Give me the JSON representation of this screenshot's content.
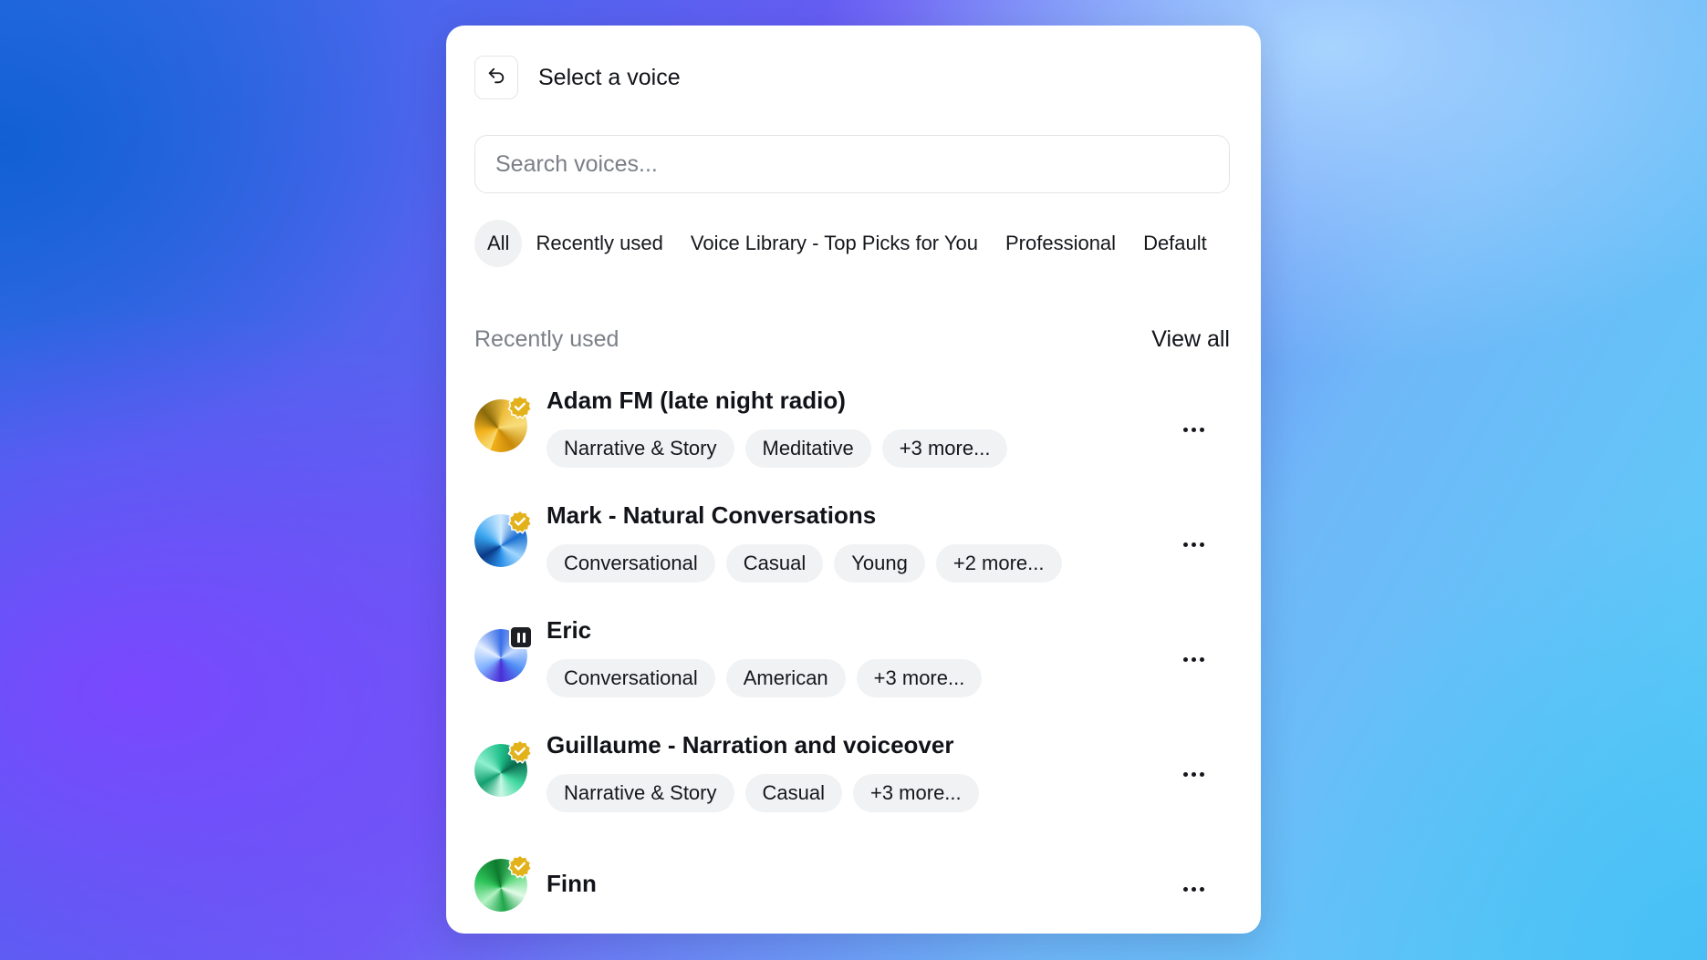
{
  "header": {
    "title": "Select a voice",
    "back_icon": "undo-arrow-icon"
  },
  "search": {
    "placeholder": "Search voices...",
    "value": ""
  },
  "tabs": [
    {
      "label": "All",
      "active": true
    },
    {
      "label": "Recently used",
      "active": false
    },
    {
      "label": "Voice Library - Top Picks for You",
      "active": false
    },
    {
      "label": "Professional",
      "active": false
    },
    {
      "label": "Default",
      "active": false
    }
  ],
  "section": {
    "title": "Recently used",
    "view_all": "View all"
  },
  "voices": [
    {
      "name": "Adam FM (late night radio)",
      "tags": [
        "Narrative & Story",
        "Meditative",
        "+3 more..."
      ],
      "badge": "verified-icon",
      "avatar_colors": [
        "#f4b11c",
        "#8a6a0a",
        "#f7dd7a"
      ]
    },
    {
      "name": "Mark - Natural Conversations",
      "tags": [
        "Conversational",
        "Casual",
        "Young",
        "+2 more..."
      ],
      "badge": "verified-icon",
      "avatar_colors": [
        "#2a8fe8",
        "#0a3a88",
        "#9fd6ff"
      ]
    },
    {
      "name": "Eric",
      "tags": [
        "Conversational",
        "American",
        "+3 more..."
      ],
      "badge": "pause-icon",
      "avatar_colors": [
        "#4f8ef5",
        "#4b2fd6",
        "#c7dcff"
      ]
    },
    {
      "name": "Guillaume - Narration and voiceover",
      "tags": [
        "Narrative & Story",
        "Casual",
        "+3 more..."
      ],
      "badge": "verified-icon",
      "avatar_colors": [
        "#1fbf8a",
        "#0a6a4c",
        "#8ff0cf"
      ]
    },
    {
      "name": "Finn",
      "tags": [],
      "badge": "verified-icon",
      "avatar_colors": [
        "#2ec45a",
        "#0d7a2e",
        "#b4f2c4"
      ]
    }
  ],
  "colors": {
    "verified_badge": "#e3b21b",
    "tag_background": "#f1f2f4",
    "text_primary": "#111318",
    "text_muted": "#7b7f87"
  }
}
